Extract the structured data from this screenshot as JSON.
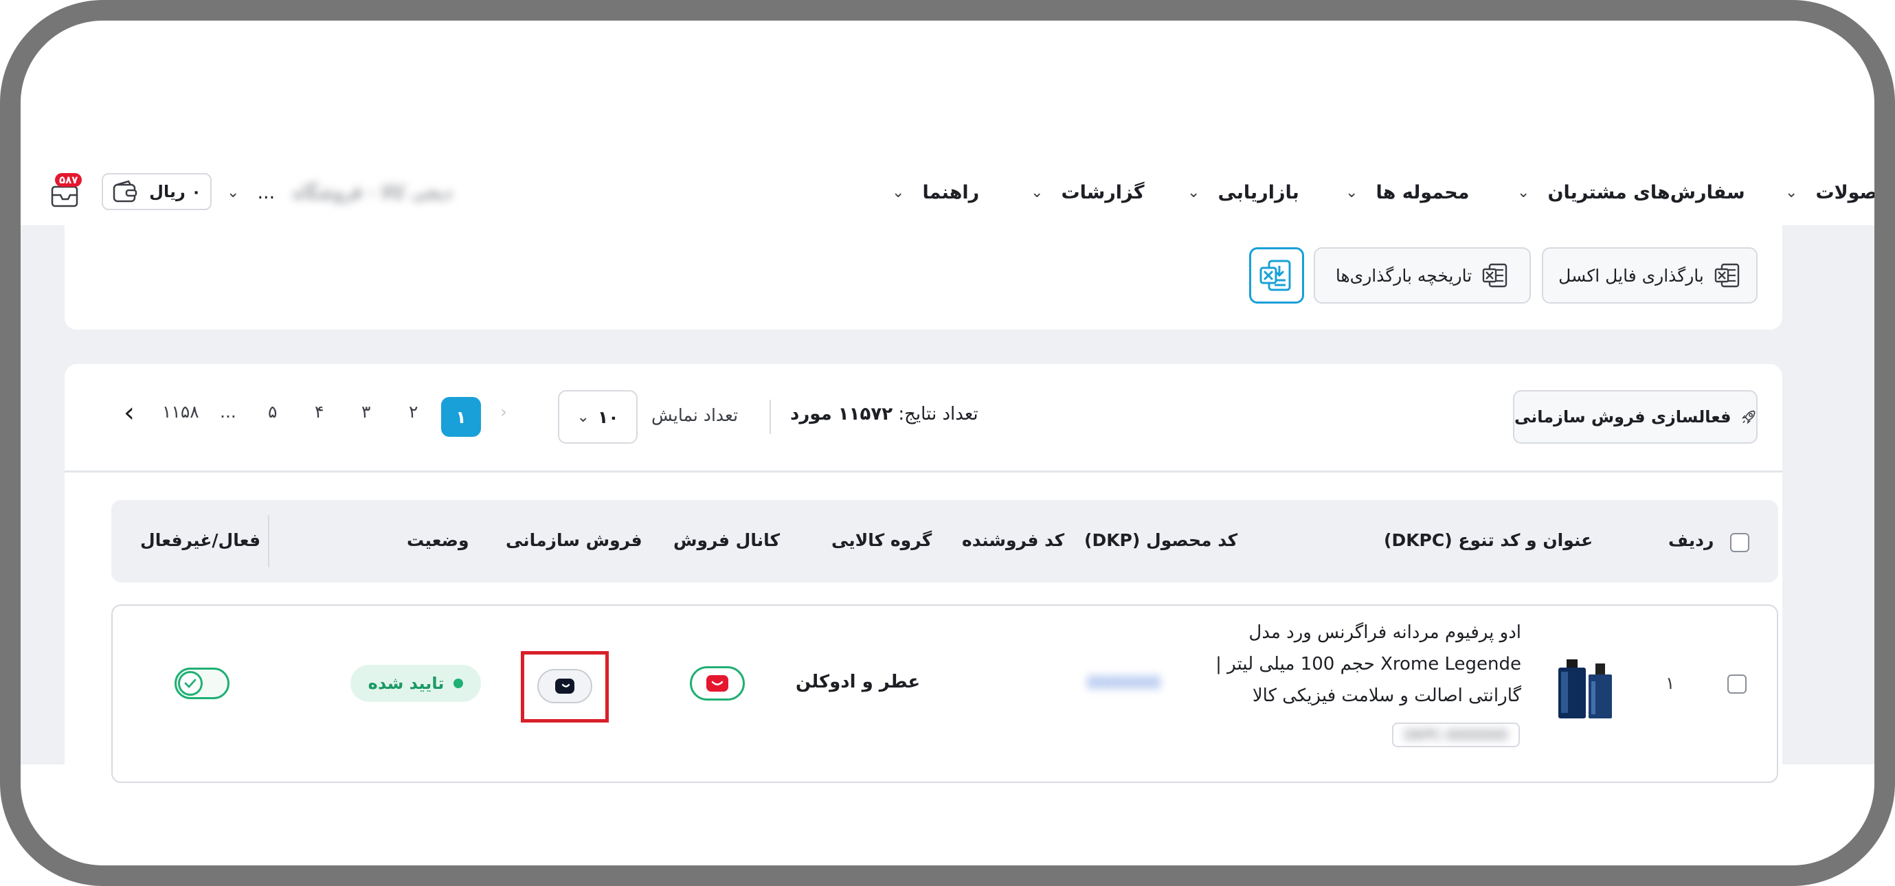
{
  "nav": {
    "items": [
      "محصولات",
      "سفارش‌های مشتریان",
      "محموله ها",
      "بازاریابی",
      "گزارشات",
      "راهنما"
    ],
    "account_name": "...",
    "account_hidden": "دیجی کالا - فروشگاه",
    "wallet": "۰ ریال",
    "notification_badge": "۵۸۷"
  },
  "upload": {
    "excel_upload": "بارگذاری فایل اکسل",
    "upload_history": "تاریخچه بارگذاری‌ها"
  },
  "list": {
    "activate_button": "فعالسازی فروش سازمانی",
    "results_label": "تعداد نتایج:",
    "results_count": "۱۱۵۷۲ مورد",
    "per_page_label": "تعداد نمایش",
    "per_page_value": "۱۰",
    "pages": [
      "۱",
      "۲",
      "۳",
      "۴",
      "۵",
      "...",
      "۱۱۵۸"
    ],
    "current_page": "۱"
  },
  "table": {
    "headers": {
      "row": "ردیف",
      "title": "عنوان و کد تنوع (DKPC)",
      "dkp": "کد محصول (DKP)",
      "seller_code": "کد فروشنده",
      "category": "گروه کالایی",
      "channel": "کانال فروش",
      "b2b": "فروش سازمانی",
      "status": "وضعیت",
      "active": "فعال/غیرفعال"
    },
    "rows": [
      {
        "index": "۱",
        "title_lines": [
          "ادو پرفیوم مردانه فراگرنس ورد مدل",
          "Xrome Legende حجم 100 میلی لیتر |",
          "گارانتی اصالت و سلامت فیزیکی کالا"
        ],
        "dkpc": "DKPC-0000000",
        "dkp": "0000000",
        "category": "عطر و ادوکلن",
        "status": "تایید شده"
      }
    ]
  },
  "colors": {
    "accent_blue": "#19a0d8",
    "green": "#1fb074",
    "red_brand": "#e5172f",
    "highlight_red": "#d9202a"
  }
}
